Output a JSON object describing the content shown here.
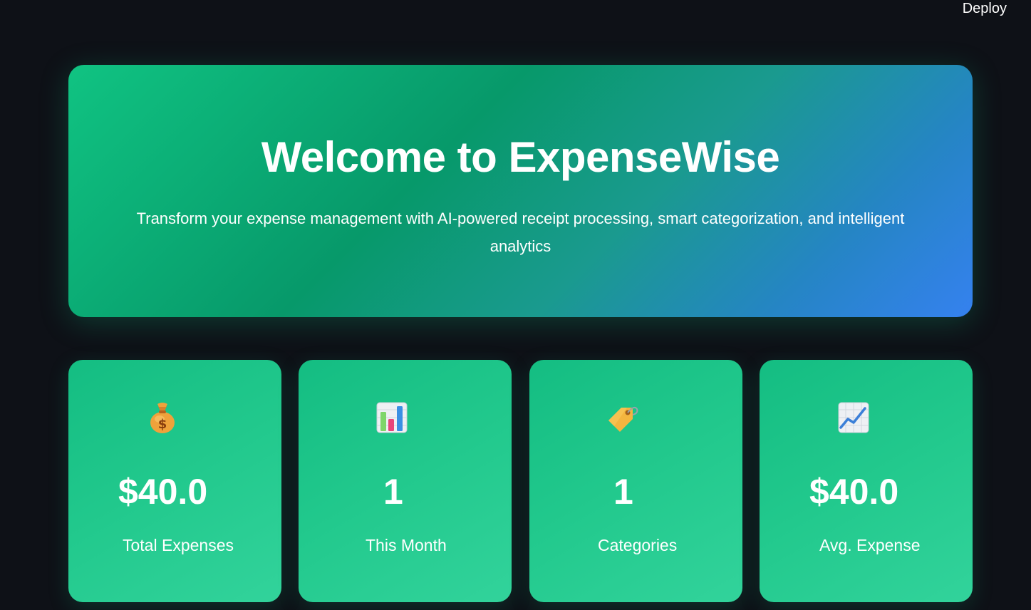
{
  "toolbar": {
    "deploy_label": "Deploy"
  },
  "hero": {
    "title": "Welcome to ExpenseWise",
    "subtitle": "Transform your expense management with AI-powered receipt processing, smart categorization, and intelligent analytics"
  },
  "metrics": [
    {
      "icon": "money-bag-icon",
      "value": "$40.0",
      "label": "Total Expenses"
    },
    {
      "icon": "bar-chart-icon",
      "value": "1",
      "label": "This Month"
    },
    {
      "icon": "tag-icon",
      "value": "1",
      "label": "Categories"
    },
    {
      "icon": "trending-up-chart-icon",
      "value": "$40.0",
      "label": "Avg. Expense"
    }
  ]
}
